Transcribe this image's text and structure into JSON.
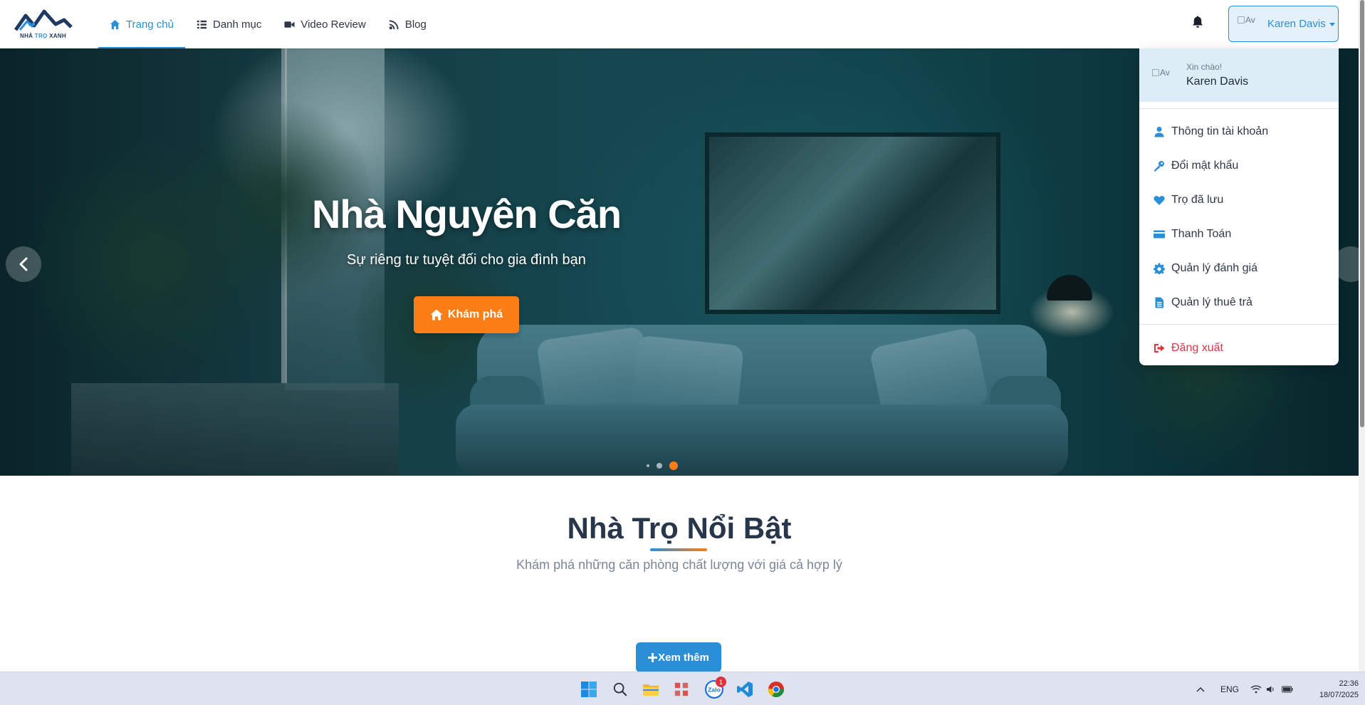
{
  "navbar": {
    "logo_text_1": "NHÀ",
    "logo_text_2": "TRỌ",
    "logo_text_3": "XANH",
    "links": [
      {
        "label": "Trang chủ",
        "icon": "home-icon",
        "active": true
      },
      {
        "label": "Danh mục",
        "icon": "list-icon",
        "active": false
      },
      {
        "label": "Video Review",
        "icon": "video-icon",
        "active": false
      },
      {
        "label": "Blog",
        "icon": "blog-icon",
        "active": false
      }
    ],
    "avatar_alt": "Av",
    "user_name": "Karen Davis"
  },
  "hero": {
    "title": "Nhà Nguyên Căn",
    "subtitle": "Sự riêng tư tuyệt đối cho gia đình bạn",
    "cta_label": "Khám phá",
    "slide_count": 3,
    "active_slide": 3
  },
  "dropdown": {
    "avatar_alt": "Av",
    "greeting": "Xin chào!",
    "name": "Karen Davis",
    "items": [
      {
        "label": "Thông tin tài khoản",
        "icon": "user-icon"
      },
      {
        "label": "Đổi mật khẩu",
        "icon": "key-icon"
      },
      {
        "label": "Trọ đã lưu",
        "icon": "heart-icon"
      },
      {
        "label": "Thanh Toán",
        "icon": "credit-card-icon"
      },
      {
        "label": "Quản lý đánh giá",
        "icon": "gear-icon"
      },
      {
        "label": "Quản lý thuê trả",
        "icon": "document-icon"
      }
    ],
    "logout_label": "Đăng xuất"
  },
  "section": {
    "title": "Nhà Trọ Nổi Bật",
    "subtitle": "Khám phá những căn phòng chất lượng với giá cả hợp lý",
    "more_label": "Xem thêm"
  },
  "taskbar": {
    "zalo_label": "Zalo",
    "zalo_badge": "1",
    "language": "ENG",
    "time": "22:36",
    "date": "18/07/2025"
  },
  "colors": {
    "primary": "#2a8fd6",
    "accent": "#fd7e14",
    "danger": "#dc3545",
    "heading": "#27364a"
  }
}
